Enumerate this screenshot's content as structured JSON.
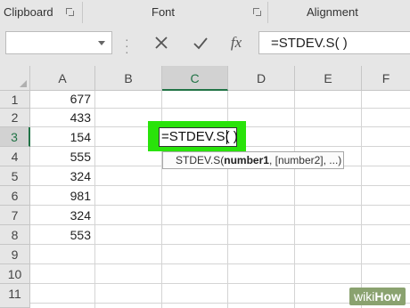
{
  "ribbon": {
    "groups": [
      {
        "label": "Clipboard"
      },
      {
        "label": "Font"
      },
      {
        "label": "Alignment"
      }
    ]
  },
  "formula_bar": {
    "name_box_value": "",
    "cancel_icon": "x-icon",
    "enter_icon": "checkmark-icon",
    "function_icon": "fx-icon",
    "function_label": "fx",
    "formula_value": "=STDEV.S( )"
  },
  "grid": {
    "columns": [
      "A",
      "B",
      "C",
      "D",
      "E",
      "F"
    ],
    "active_column": "C",
    "rows": [
      "1",
      "2",
      "3",
      "4",
      "5",
      "6",
      "7",
      "8",
      "9",
      "10",
      "11"
    ],
    "active_row": "3",
    "column_a_values": [
      "677",
      "433",
      "154",
      "555",
      "324",
      "981",
      "324",
      "553"
    ],
    "active_cell_text": "=STDEV.S( )",
    "highlight_color": "#29e30a"
  },
  "tooltip": {
    "fn_name": "STDEV.S(",
    "arg1": "number1",
    "rest": ", [number2], ...)"
  },
  "watermark": {
    "prefix": "wiki",
    "suffix": "How"
  }
}
